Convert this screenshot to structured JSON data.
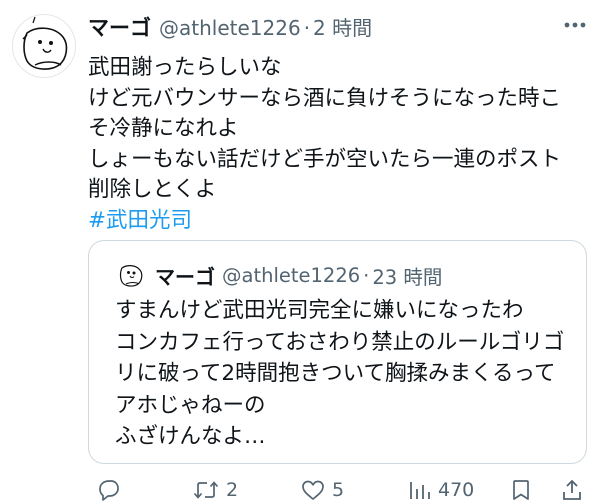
{
  "tweet": {
    "display_name": "マーゴ",
    "handle": "@athlete1226",
    "separator": "·",
    "time": "2 時間",
    "lines": [
      "武田謝ったらしいな",
      "けど元バウンサーなら酒に負けそうになった時こ",
      "そ冷静になれよ",
      "しょーもない話だけど手が空いたら一連のポスト",
      "削除しとくよ"
    ],
    "hashtag": "#武田光司"
  },
  "quoted": {
    "display_name": "マーゴ",
    "handle": "@athlete1226",
    "separator": "·",
    "time": "23 時間",
    "lines": [
      "すまんけど武田光司完全に嫌いになったわ",
      "コンカフェ行っておさわり禁止のルールゴリゴ",
      "リに破って2時間抱きついて胸揉みまくるって",
      "アホじゃねーの",
      "ふざけんなよ…"
    ]
  },
  "actions": {
    "reply_count": "",
    "repost_count": "2",
    "like_count": "5",
    "views_count": "470"
  },
  "colors": {
    "text": "#0f1419",
    "secondary": "#536471",
    "link": "#1d9bf0",
    "border": "#cfd9de"
  },
  "icons": [
    "avatar-doodle",
    "more-icon",
    "reply-icon",
    "repost-icon",
    "like-icon",
    "views-icon",
    "bookmark-icon",
    "share-icon"
  ]
}
